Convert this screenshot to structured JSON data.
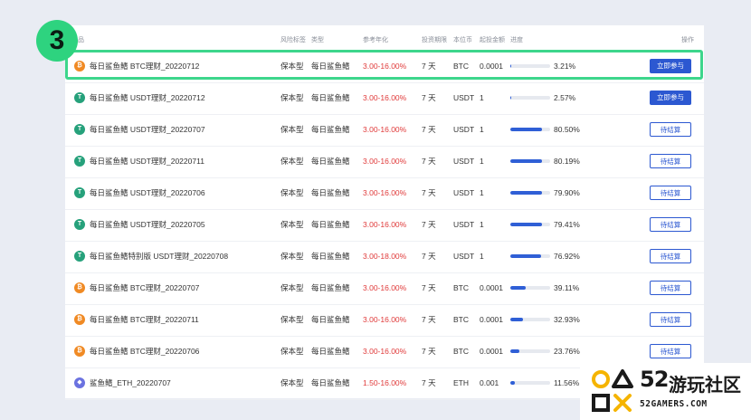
{
  "step_badge": "3",
  "table": {
    "headers": {
      "product": "品",
      "risk": "风险标签",
      "type": "类型",
      "yield": "参考年化",
      "period": "投资期限",
      "currency": "本位币",
      "min": "起投金额",
      "progress": "进度",
      "action": "操作"
    },
    "rows": [
      {
        "coin": "BTC",
        "coin_color": "#f08a24",
        "coin_glyph": "₿",
        "name": "每日鲨鱼鳍 BTC理财_20220712",
        "risk": "保本型",
        "type": "每日鲨鱼鳍",
        "yield": "3.00-16.00%",
        "period": "7 天",
        "currency": "BTC",
        "min": "0.0001",
        "progress": 3.21,
        "progress_label": "3.21%",
        "action": "立即参与",
        "action_style": "join"
      },
      {
        "coin": "USDT",
        "coin_color": "#26a17b",
        "coin_glyph": "T",
        "name": "每日鲨鱼鳍 USDT理财_20220712",
        "risk": "保本型",
        "type": "每日鲨鱼鳍",
        "yield": "3.00-16.00%",
        "period": "7 天",
        "currency": "USDT",
        "min": "1",
        "progress": 2.57,
        "progress_label": "2.57%",
        "action": "立即参与",
        "action_style": "join"
      },
      {
        "coin": "USDT",
        "coin_color": "#26a17b",
        "coin_glyph": "T",
        "name": "每日鲨鱼鳍 USDT理财_20220707",
        "risk": "保本型",
        "type": "每日鲨鱼鳍",
        "yield": "3.00-16.00%",
        "period": "7 天",
        "currency": "USDT",
        "min": "1",
        "progress": 80.5,
        "progress_label": "80.50%",
        "action": "待结算",
        "action_style": "wait"
      },
      {
        "coin": "USDT",
        "coin_color": "#26a17b",
        "coin_glyph": "T",
        "name": "每日鲨鱼鳍 USDT理财_20220711",
        "risk": "保本型",
        "type": "每日鲨鱼鳍",
        "yield": "3.00-16.00%",
        "period": "7 天",
        "currency": "USDT",
        "min": "1",
        "progress": 80.19,
        "progress_label": "80.19%",
        "action": "待结算",
        "action_style": "wait"
      },
      {
        "coin": "USDT",
        "coin_color": "#26a17b",
        "coin_glyph": "T",
        "name": "每日鲨鱼鳍 USDT理财_20220706",
        "risk": "保本型",
        "type": "每日鲨鱼鳍",
        "yield": "3.00-16.00%",
        "period": "7 天",
        "currency": "USDT",
        "min": "1",
        "progress": 79.9,
        "progress_label": "79.90%",
        "action": "待结算",
        "action_style": "wait"
      },
      {
        "coin": "USDT",
        "coin_color": "#26a17b",
        "coin_glyph": "T",
        "name": "每日鲨鱼鳍 USDT理财_20220705",
        "risk": "保本型",
        "type": "每日鲨鱼鳍",
        "yield": "3.00-16.00%",
        "period": "7 天",
        "currency": "USDT",
        "min": "1",
        "progress": 79.41,
        "progress_label": "79.41%",
        "action": "待结算",
        "action_style": "wait"
      },
      {
        "coin": "USDT",
        "coin_color": "#26a17b",
        "coin_glyph": "T",
        "name": "每日鲨鱼鳍特别版 USDT理财_20220708",
        "risk": "保本型",
        "type": "每日鲨鱼鳍",
        "yield": "3.00-18.00%",
        "period": "7 天",
        "currency": "USDT",
        "min": "1",
        "progress": 76.92,
        "progress_label": "76.92%",
        "action": "待结算",
        "action_style": "wait"
      },
      {
        "coin": "BTC",
        "coin_color": "#f08a24",
        "coin_glyph": "₿",
        "name": "每日鲨鱼鳍 BTC理财_20220707",
        "risk": "保本型",
        "type": "每日鲨鱼鳍",
        "yield": "3.00-16.00%",
        "period": "7 天",
        "currency": "BTC",
        "min": "0.0001",
        "progress": 39.11,
        "progress_label": "39.11%",
        "action": "待结算",
        "action_style": "wait"
      },
      {
        "coin": "BTC",
        "coin_color": "#f08a24",
        "coin_glyph": "₿",
        "name": "每日鲨鱼鳍 BTC理财_20220711",
        "risk": "保本型",
        "type": "每日鲨鱼鳍",
        "yield": "3.00-16.00%",
        "period": "7 天",
        "currency": "BTC",
        "min": "0.0001",
        "progress": 32.93,
        "progress_label": "32.93%",
        "action": "待结算",
        "action_style": "wait"
      },
      {
        "coin": "BTC",
        "coin_color": "#f08a24",
        "coin_glyph": "₿",
        "name": "每日鲨鱼鳍 BTC理财_20220706",
        "risk": "保本型",
        "type": "每日鲨鱼鳍",
        "yield": "3.00-16.00%",
        "period": "7 天",
        "currency": "BTC",
        "min": "0.0001",
        "progress": 23.76,
        "progress_label": "23.76%",
        "action": "待结算",
        "action_style": "wait"
      },
      {
        "coin": "ETH",
        "coin_color": "#6b72e0",
        "coin_glyph": "◆",
        "name": "鲨鱼鳍_ETH_20220707",
        "risk": "保本型",
        "type": "每日鲨鱼鳍",
        "yield": "1.50-16.00%",
        "period": "7 天",
        "currency": "ETH",
        "min": "0.001",
        "progress": 11.56,
        "progress_label": "11.56%",
        "action": "",
        "action_style": "none"
      }
    ]
  },
  "watermark": {
    "number": "52",
    "name": "游玩社区",
    "url": "52GAMERS.COM"
  }
}
